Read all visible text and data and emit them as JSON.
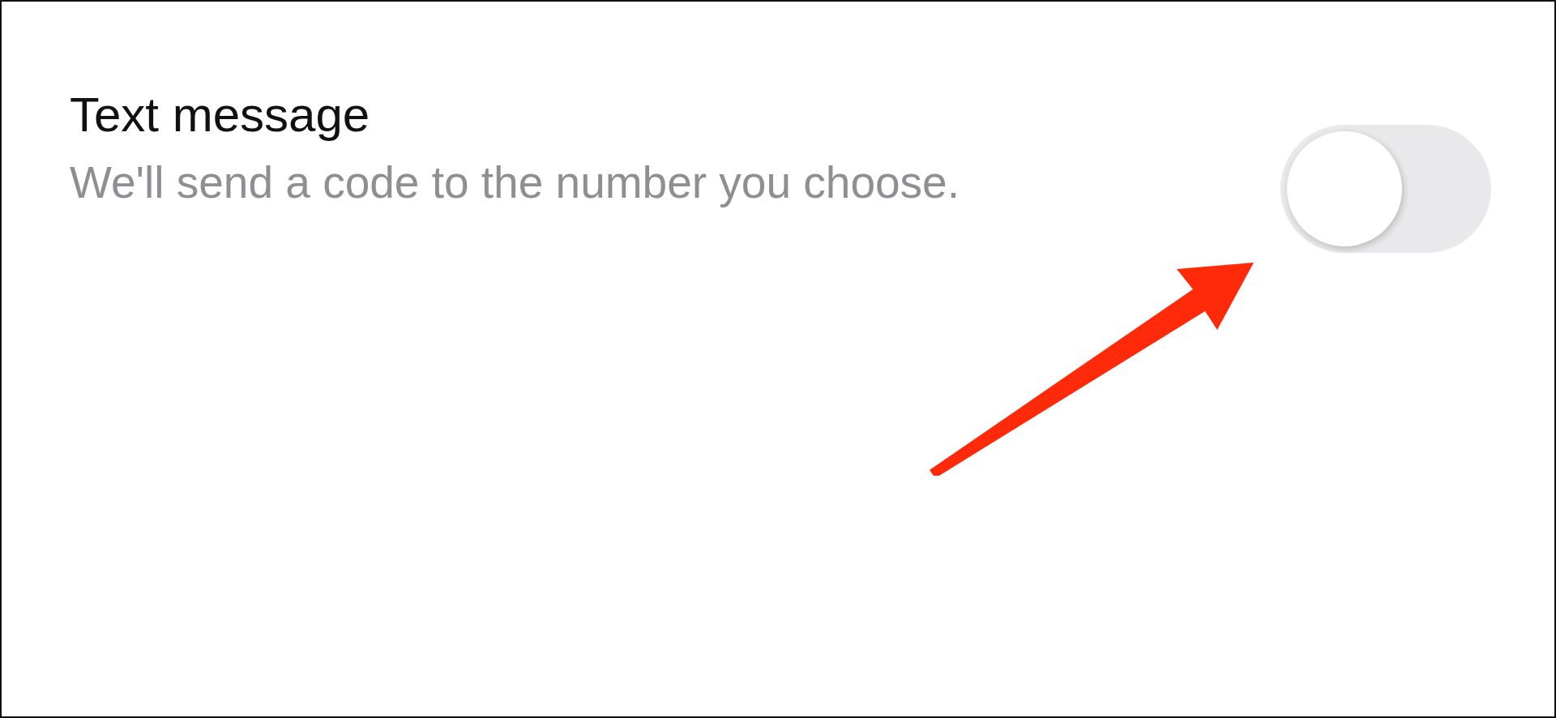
{
  "setting": {
    "title": "Text message",
    "description": "We'll send a code to the number you choose.",
    "on": false
  }
}
